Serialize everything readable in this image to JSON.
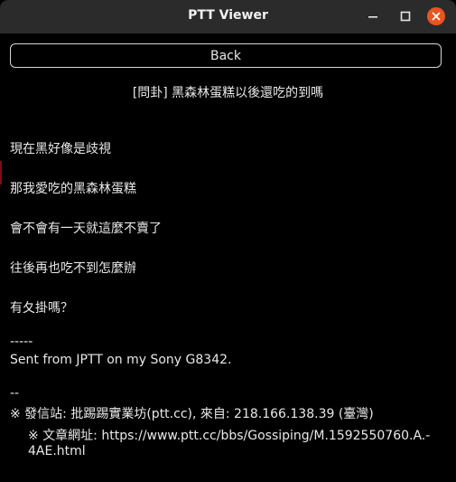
{
  "window": {
    "title": "PTT Viewer"
  },
  "toolbar": {
    "back_label": "Back"
  },
  "post": {
    "title": "[問卦] 黑森林蛋糕以後還吃的到嗎",
    "body_lines": [
      "現在黑好像是歧視",
      "那我愛吃的黑森林蛋糕",
      "會不會有一天就這麼不賣了",
      "往後再也吃不到怎麼辦",
      "有夂掛嗎？"
    ],
    "signature_sep": "-----",
    "signature": "Sent from JPTT on my Sony G8342.",
    "footer_sep": "--",
    "origin_line": "※ 發信站: 批踢踢實業坊(ptt.cc), 來自: 218.166.138.39 (臺灣)",
    "url_line_1": "※ 文章網址: https://www.ptt.cc/bbs/Gossiping/M.1592550760.A.-",
    "url_line_2": "4AE.html"
  },
  "colors": {
    "background": "#000000",
    "titlebar": "#2b2b2b",
    "close_button": "#e95420",
    "text": "#e8e8e8"
  }
}
